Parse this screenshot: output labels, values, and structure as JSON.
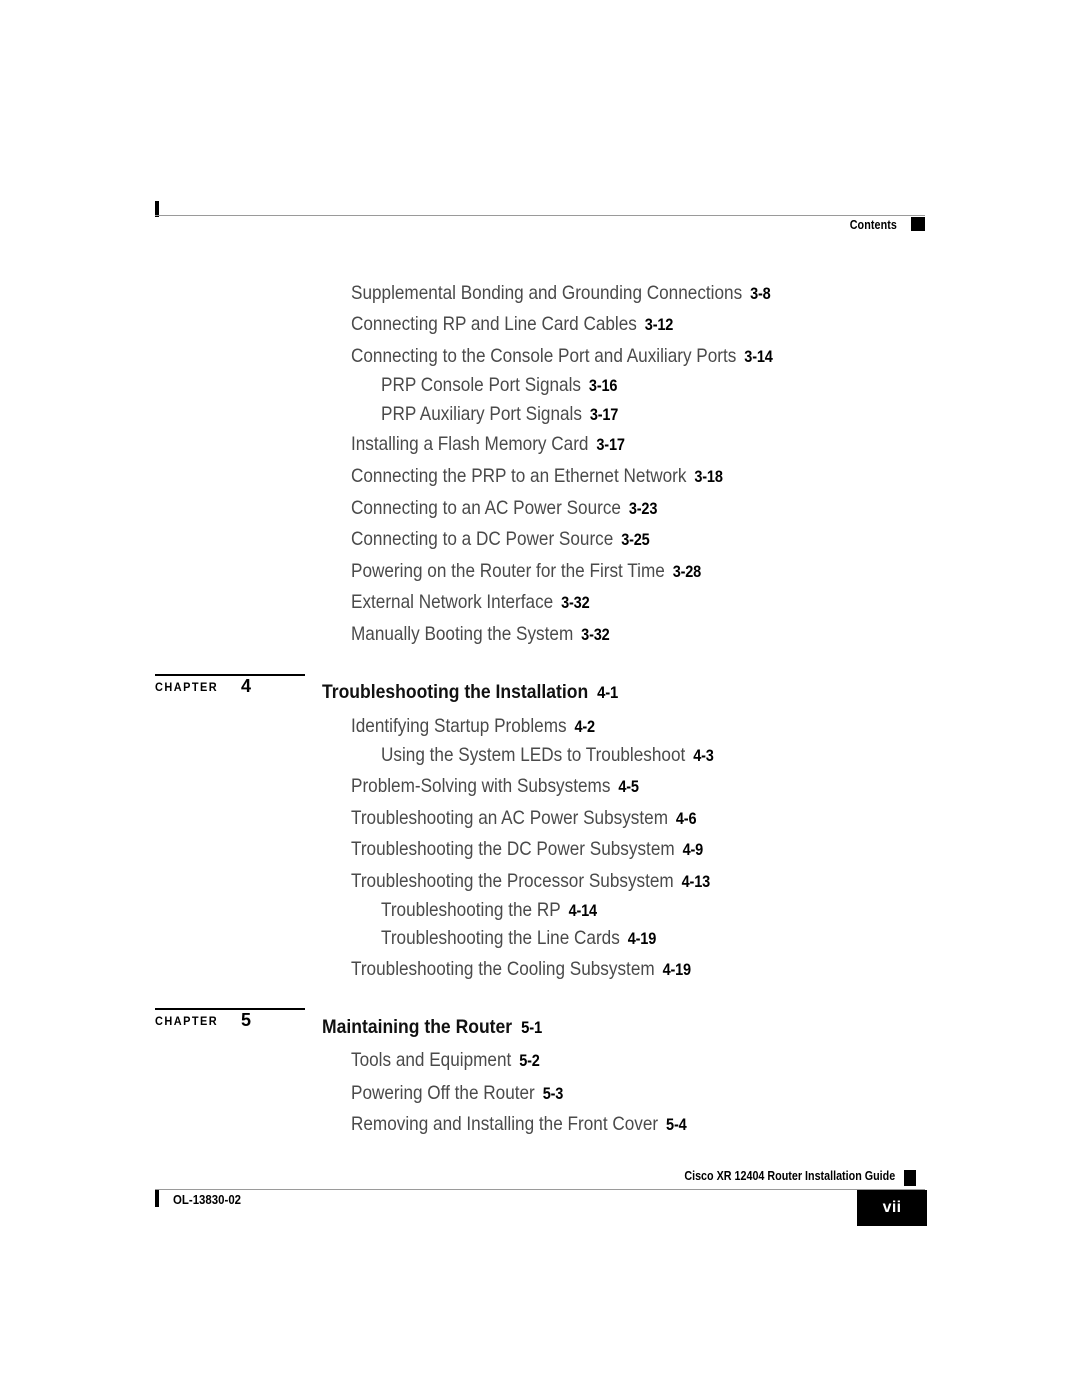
{
  "header": {
    "label": "Contents",
    "marker_icon": "black-square-marker"
  },
  "toc": {
    "sections": [
      {
        "id": "chapter-3-continued",
        "entries": [
          {
            "level": 1,
            "title": "Supplemental Bonding and Grounding Connections",
            "page": "3-8"
          },
          {
            "level": 1,
            "title": "Connecting RP and Line Card Cables",
            "page": "3-12"
          },
          {
            "level": 1,
            "title": "Connecting to the Console Port and Auxiliary Ports",
            "page": "3-14"
          },
          {
            "level": 2,
            "title": "PRP Console Port Signals",
            "page": "3-16"
          },
          {
            "level": 2,
            "title": "PRP Auxiliary Port Signals",
            "page": "3-17"
          },
          {
            "level": 1,
            "title": "Installing a Flash Memory Card",
            "page": "3-17"
          },
          {
            "level": 1,
            "title": "Connecting the PRP to an Ethernet Network",
            "page": "3-18"
          },
          {
            "level": 1,
            "title": "Connecting to an AC Power Source",
            "page": "3-23"
          },
          {
            "level": 1,
            "title": "Connecting to a DC Power Source",
            "page": "3-25"
          },
          {
            "level": 1,
            "title": "Powering on the Router for the First Time",
            "page": "3-28"
          },
          {
            "level": 1,
            "title": "External Network Interface",
            "page": "3-32"
          },
          {
            "level": 1,
            "title": "Manually Booting the System",
            "page": "3-32"
          }
        ]
      },
      {
        "id": "chapter-4",
        "chapter_word": "CHAPTER",
        "chapter_number": "4",
        "chapter_title": "Troubleshooting the Installation",
        "chapter_page": "4-1",
        "entries": [
          {
            "level": 1,
            "title": "Identifying Startup Problems",
            "page": "4-2"
          },
          {
            "level": 2,
            "title": "Using the System LEDs to Troubleshoot",
            "page": "4-3"
          },
          {
            "level": 1,
            "title": "Problem-Solving with Subsystems",
            "page": "4-5"
          },
          {
            "level": 1,
            "title": "Troubleshooting an AC Power Subsystem",
            "page": "4-6"
          },
          {
            "level": 1,
            "title": "Troubleshooting the DC Power Subsystem",
            "page": "4-9"
          },
          {
            "level": 1,
            "title": "Troubleshooting the Processor Subsystem",
            "page": "4-13"
          },
          {
            "level": 2,
            "title": "Troubleshooting the RP",
            "page": "4-14"
          },
          {
            "level": 2,
            "title": "Troubleshooting the Line Cards",
            "page": "4-19"
          },
          {
            "level": 1,
            "title": "Troubleshooting the Cooling Subsystem",
            "page": "4-19"
          }
        ]
      },
      {
        "id": "chapter-5",
        "chapter_word": "CHAPTER",
        "chapter_number": "5",
        "chapter_title": "Maintaining the Router",
        "chapter_page": "5-1",
        "entries": [
          {
            "level": 1,
            "title": "Tools and Equipment",
            "page": "5-2"
          },
          {
            "level": 1,
            "title": "Powering Off the Router",
            "page": "5-3"
          },
          {
            "level": 1,
            "title": "Removing and Installing the Front Cover",
            "page": "5-4"
          }
        ]
      }
    ]
  },
  "footer": {
    "guide_title": "Cisco XR 12404 Router Installation Guide",
    "doc_id": "OL-13830-02",
    "page_number": "vii",
    "marker_icon": "black-square-marker"
  },
  "colors": {
    "body_text": "#4a4a4a",
    "heading_text": "#111111",
    "page_number": "#000000",
    "rule": "#9a9a9a",
    "marker": "#000000"
  }
}
